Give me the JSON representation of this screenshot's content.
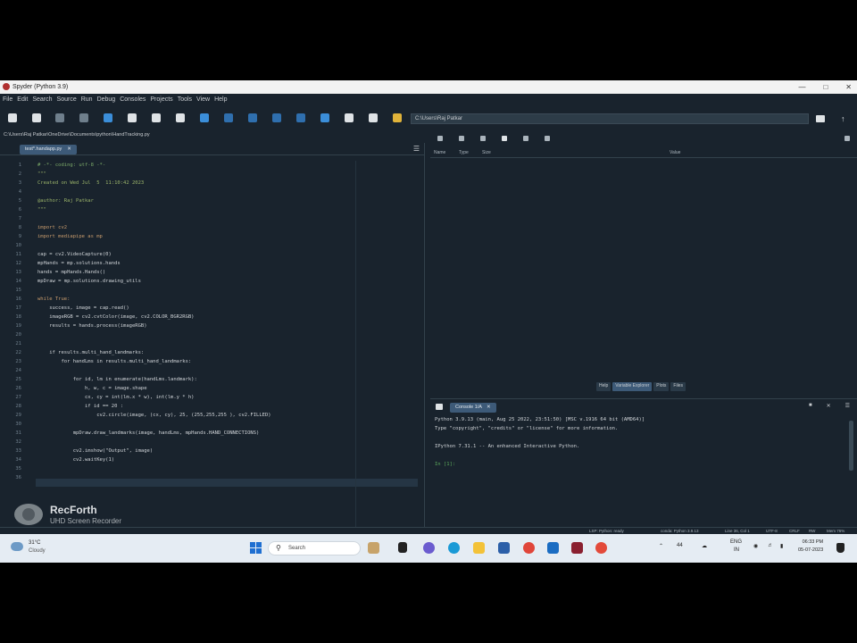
{
  "window": {
    "title": "Spyder (Python 3.9)",
    "controls": [
      "—",
      "□",
      "✕"
    ]
  },
  "menubar": [
    "File",
    "Edit",
    "Search",
    "Source",
    "Run",
    "Debug",
    "Consoles",
    "Projects",
    "Tools",
    "View",
    "Help"
  ],
  "toolbar": {
    "working_dir": "C:\\Users\\Raj Patkar"
  },
  "editor": {
    "file_path": "C:\\Users\\Raj Patkar\\OneDrive\\Documents\\python\\HandTracking.py",
    "tab_label": "test*.handapp.py",
    "lines": [
      {
        "n": "1",
        "t": "# -*- coding: utf-8 -*-",
        "k": "cm"
      },
      {
        "n": "2",
        "t": "\"\"\"",
        "k": "str"
      },
      {
        "n": "3",
        "t": "Created on Wed Jul  5  11:10:42 2023",
        "k": "str"
      },
      {
        "n": "4",
        "t": "",
        "k": ""
      },
      {
        "n": "5",
        "t": "@author: Raj Patkar",
        "k": "str"
      },
      {
        "n": "6",
        "t": "\"\"\"",
        "k": "str"
      },
      {
        "n": "7",
        "t": "",
        "k": ""
      },
      {
        "n": "8",
        "t": "import cv2",
        "k": "kw"
      },
      {
        "n": "9",
        "t": "import mediapipe as mp",
        "k": "kw"
      },
      {
        "n": "10",
        "t": "",
        "k": ""
      },
      {
        "n": "11",
        "t": "cap = cv2.VideoCapture(0)",
        "k": ""
      },
      {
        "n": "12",
        "t": "mpHands = mp.solutions.hands",
        "k": ""
      },
      {
        "n": "13",
        "t": "hands = mpHands.Hands()",
        "k": ""
      },
      {
        "n": "14",
        "t": "mpDraw = mp.solutions.drawing_utils",
        "k": ""
      },
      {
        "n": "15",
        "t": "",
        "k": ""
      },
      {
        "n": "16",
        "t": "while True:",
        "k": "kw"
      },
      {
        "n": "17",
        "t": "    success, image = cap.read()",
        "k": ""
      },
      {
        "n": "18",
        "t": "    imageRGB = cv2.cvtColor(image, cv2.COLOR_BGR2RGB)",
        "k": ""
      },
      {
        "n": "19",
        "t": "    results = hands.process(imageRGB)",
        "k": ""
      },
      {
        "n": "20",
        "t": "",
        "k": ""
      },
      {
        "n": "21",
        "t": "",
        "k": ""
      },
      {
        "n": "22",
        "t": "    if results.multi_hand_landmarks:",
        "k": ""
      },
      {
        "n": "23",
        "t": "        for handLms in results.multi_hand_landmarks:",
        "k": ""
      },
      {
        "n": "24",
        "t": "",
        "k": ""
      },
      {
        "n": "25",
        "t": "            for id, lm in enumerate(handLms.landmark):",
        "k": ""
      },
      {
        "n": "26",
        "t": "                h, w, c = image.shape",
        "k": ""
      },
      {
        "n": "27",
        "t": "                cx, cy = int(lm.x * w), int(lm.y * h)",
        "k": ""
      },
      {
        "n": "28",
        "t": "                if id == 20 :",
        "k": ""
      },
      {
        "n": "29",
        "t": "                    cv2.circle(image, (cx, cy), 25, (255,255,255 ), cv2.FILLED)",
        "k": ""
      },
      {
        "n": "30",
        "t": "",
        "k": ""
      },
      {
        "n": "31",
        "t": "            mpDraw.draw_landmarks(image, handLms, mpHands.HAND_CONNECTIONS)",
        "k": ""
      },
      {
        "n": "32",
        "t": "",
        "k": ""
      },
      {
        "n": "33",
        "t": "            cv2.imshow(\"Output\", image)",
        "k": ""
      },
      {
        "n": "34",
        "t": "            cv2.waitKey(1)",
        "k": ""
      },
      {
        "n": "35",
        "t": "",
        "k": ""
      },
      {
        "n": "36",
        "t": "",
        "k": ""
      }
    ]
  },
  "explorer": {
    "columns": [
      "Name",
      "Type",
      "Size",
      "Value"
    ],
    "tabs": [
      "Help",
      "Variable Explorer",
      "Plots",
      "Files"
    ],
    "active_tab": "Variable Explorer"
  },
  "console": {
    "tab_label": "Console 1/A",
    "lines": [
      "Python 3.9.13 (main, Aug 25 2022, 23:51:50) [MSC v.1916 64 bit (AMD64)]",
      "Type \"copyright\", \"credits\" or \"license\" for more information.",
      "",
      "IPython 7.31.1 -- An enhanced Interactive Python.",
      "",
      "In [1]:"
    ]
  },
  "statusbar": {
    "lsp": "LSP: Python: ready",
    "conda": "conda: Python 3.9.13",
    "position": "Line 36, Col 1",
    "encoding": "UTF-8",
    "eol": "CRLF",
    "rw": "RW",
    "mem": "Mem 76%"
  },
  "watermark": {
    "name": "RecForth",
    "subtitle": "UHD Screen Recorder"
  },
  "taskbar": {
    "temp": "31°C",
    "condition": "Cloudy",
    "search_placeholder": "Search",
    "tray_count": "44",
    "lang": "ENG",
    "region": "IN",
    "time": "06:33 PM",
    "date": "05-07-2023"
  },
  "colors": {
    "ide_bg": "#19232d",
    "accent": "#3d5a78",
    "taskbar_bg": "#e5ecf3"
  }
}
